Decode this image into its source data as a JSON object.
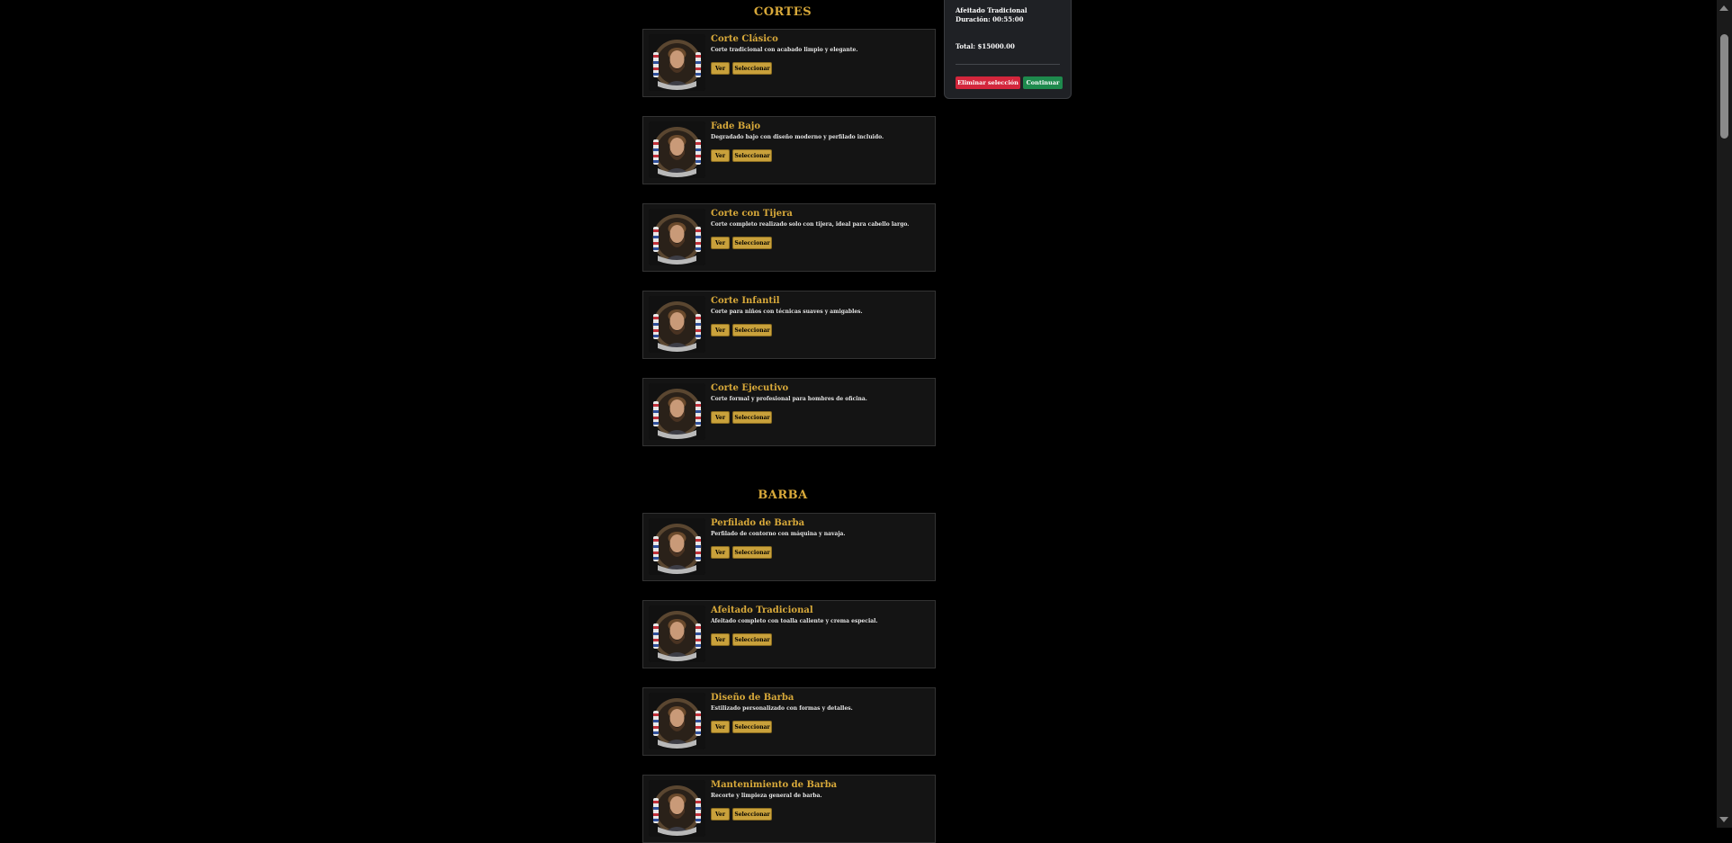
{
  "sections": [
    {
      "title": "CORTES",
      "services": [
        {
          "name": "Corte Clásico",
          "desc": "Corte tradicional con acabado limpio y elegante."
        },
        {
          "name": "Fade Bajo",
          "desc": "Degradado bajo con diseño moderno y perfilado incluido."
        },
        {
          "name": "Corte con Tijera",
          "desc": "Corte completo realizado solo con tijera, ideal para cabello largo."
        },
        {
          "name": "Corte Infantil",
          "desc": "Corte para niños con técnicas suaves y amigables."
        },
        {
          "name": "Corte Ejecutivo",
          "desc": "Corte formal y profesional para hombres de oficina."
        }
      ]
    },
    {
      "title": "BARBA",
      "services": [
        {
          "name": "Perfilado de Barba",
          "desc": "Perfilado de contorno con máquina y navaja."
        },
        {
          "name": "Afeitado Tradicional",
          "desc": "Afeitado completo con toalla caliente y crema especial."
        },
        {
          "name": "Diseño de Barba",
          "desc": "Estilizado personalizado con formas y detalles."
        },
        {
          "name": "Mantenimiento de Barba",
          "desc": "Recorte y limpieza general de barba."
        }
      ]
    }
  ],
  "buttons": {
    "ver": "Ver",
    "seleccionar": "Seleccionar"
  },
  "panel": {
    "selected_service": "Afeitado Tradicional",
    "duration": "Duración: 00:55:00",
    "total": "Total: $15000.00",
    "remove_label": "Eliminar selección",
    "continue_label": "Continuar"
  },
  "icons": {
    "thumbnail": "barber-logo-icon"
  },
  "colors": {
    "accent": "#d8a93a",
    "danger": "#d3263c",
    "success": "#1e8a4d",
    "background": "#000000"
  }
}
